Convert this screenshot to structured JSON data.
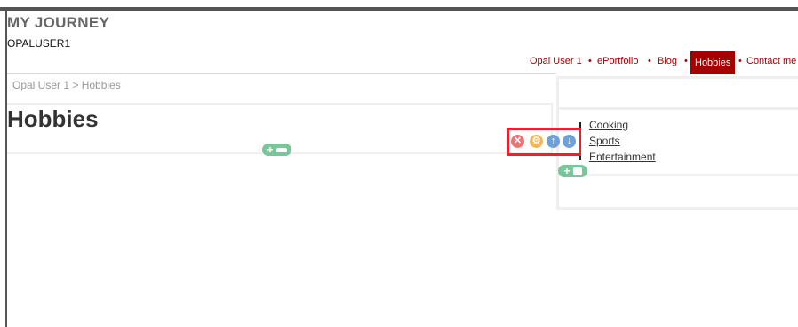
{
  "site": {
    "title": "MY JOURNEY",
    "username": "OPALUSER1"
  },
  "nav": {
    "items": [
      {
        "label": "Opal User 1"
      },
      {
        "label": "ePortfolio"
      },
      {
        "label": "Blog"
      },
      {
        "label": "Hobbies",
        "active": true
      },
      {
        "label": "Contact me"
      }
    ],
    "separator": "•",
    "active_color": "#a40000"
  },
  "breadcrumb": {
    "link": "Opal User 1",
    "rest": " > Hobbies"
  },
  "page": {
    "title": "Hobbies"
  },
  "block_tools": {
    "icons": [
      "close-icon",
      "settings-icon",
      "move-up-icon",
      "move-down-icon"
    ],
    "highlight_color": "#e8202f"
  },
  "sidebar": {
    "hobbies": [
      "Cooking",
      "Sports",
      "Entertainment"
    ]
  },
  "colors": {
    "add_button": "#7ac59a",
    "close": "#e87676",
    "settings": "#f2b65a",
    "move": "#6fa0d8"
  }
}
